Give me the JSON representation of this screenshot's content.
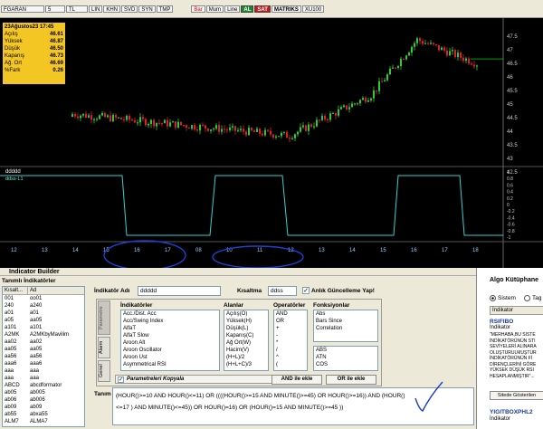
{
  "toolbar": {
    "symbol": "FGARAN",
    "period": "5",
    "currency": "TL",
    "buttons_left": [
      "L",
      "S",
      "LIN",
      "KHN",
      "SVD",
      "SYN",
      "TMP"
    ],
    "buttons_mid": [
      "Trend",
      "Yatay",
      "Prf",
      "Sil",
      "Prf",
      "Sil",
      "Fib",
      "Y",
      "Fibt",
      "Düş",
      "Paran"
    ],
    "buttons_right": [
      "Bar",
      "Mum",
      "Line",
      "Bar",
      "X"
    ],
    "al": "AL",
    "sat": "SAT",
    "matriks": "MATRIKS",
    "zoom": "XU100"
  },
  "info_box": {
    "date": "23Ağustos23 17:45",
    "rows": [
      {
        "label": "Açılış",
        "value": "46.61"
      },
      {
        "label": "Yüksek",
        "value": "46.87"
      },
      {
        "label": "Düşük",
        "value": "46.50"
      },
      {
        "label": "Kapanış",
        "value": "46.73"
      },
      {
        "label": "Ağ. Ort",
        "value": "46.69"
      },
      {
        "label": "%Fark",
        "value": "0.26"
      }
    ]
  },
  "price_axis": [
    "47.5",
    "47",
    "46.5",
    "46",
    "45.5",
    "45",
    "44.5",
    "44",
    "43.5",
    "43",
    "42.5"
  ],
  "indicator_panel": {
    "title": "ddddd",
    "subtitle": "ddss-L1",
    "axis": [
      "1",
      "0.8",
      "0.6",
      "0.4",
      "0.2",
      "0",
      "-0.2",
      "-0.4",
      "-0.6",
      "-0.8",
      "-1"
    ]
  },
  "time_axis": [
    "12",
    "13",
    "14",
    "15",
    "16",
    "17",
    "08",
    "10",
    "11",
    "12",
    "13",
    "14",
    "15",
    "16",
    "17",
    "18"
  ],
  "builder": {
    "window_title": "Indicator Builder",
    "defined_title": "Tanımlı İndikatörler",
    "col_short": "Kısalt...",
    "col_name": "Ad",
    "list": [
      [
        "001",
        "oo01"
      ],
      [
        "240",
        "a240"
      ],
      [
        "a01",
        "a01"
      ],
      [
        "a05",
        "aa05"
      ],
      [
        "a101",
        "a101"
      ],
      [
        "A2MK",
        "A2MKbyMavilim"
      ],
      [
        "aa02",
        "aa02"
      ],
      [
        "aa05",
        "aa05"
      ],
      [
        "aa56",
        "aa56"
      ],
      [
        "aaa6",
        "aaa6"
      ],
      [
        "aaa",
        "aaa"
      ],
      [
        "aaa",
        "aaa"
      ],
      [
        "ABCD",
        "abcdformator"
      ],
      [
        "ab05",
        "ab005"
      ],
      [
        "ab06",
        "ab006"
      ],
      [
        "ab09",
        "ab09"
      ],
      [
        "ab55",
        "abxa55"
      ],
      [
        "ALM7",
        "ALMA7"
      ]
    ],
    "name_label": "İndikatör Adı",
    "name_value": "ddddd",
    "short_label": "Kısaltma",
    "short_value": "ddss",
    "live_label": "Anlık Güncelleme Yap!",
    "side_tabs": [
      "Parametre",
      "Alarm",
      "Genel"
    ],
    "indicators_title": "İndikatörler",
    "indicators": [
      "Acc./Dist. Acc",
      "Acc/Swing Index",
      "AlfaT",
      "AlfaT Slow",
      "Aroon Alt",
      "Aroon Oscillator",
      "Aroon Üst",
      "Asymmetrical RSI"
    ],
    "fields_title": "Alanlar",
    "fields": [
      "Açılış(O)",
      "Yüksek(H)",
      "Düşük(L)",
      "Kapanış(C)",
      "Ağ Ort(W)",
      "Hacim(V)",
      "(H+L)/2",
      "(H+L+C)/3"
    ],
    "operators_title": "Operatörler",
    "operators": [
      "AND",
      "OR",
      "+",
      "-",
      "*",
      "/",
      "^",
      "("
    ],
    "functions_title": "Fonksiyonlar",
    "functions_top": [
      "Abs",
      "Bars Since",
      "Correlation"
    ],
    "functions_bottom": [
      "ABS",
      "ATN",
      "COS"
    ],
    "param_copy": "Parametreleri Kopyala",
    "and_btn": "AND ile ekle",
    "or_btn": "OR ile ekle",
    "def_label": "Tanım",
    "def_line1": "(HOUR()>=10 AND HOUR()<=11) OR ((((HOUR()>=15  AND MINUTE()>=45) OR HOUR()>=16)) AND (HOUR()",
    "def_line2": "<=17 ) AND MINUTE()<=45)) OR HOUR()=16) OR (HOUR()=15  AND MINUTE()>=45 ))"
  },
  "right_panel": {
    "title": "Algo Kütüphane",
    "radio1": "Sistem",
    "radio2": "Tag",
    "tab": "İndikator",
    "item1_title": "RSIFIBO",
    "item1_sub": "İndikator",
    "item1_text": "\"MERHABA,BU SİSTE İNDİKATÖRÜNÜN STI SEVİYELERİ ALINARA OLUŞTURULMUŞTUR İNDİKATÖRÜNÜN Fİ DİRENÇLERİNİ GÖRE YÜKSEK DÜŞÜK RSI HESAPLANMIŞTIR\"...",
    "item1_btn": "Sitede Gösterilen",
    "item2_title": "YIGITBOXPHL2",
    "item2_sub": "İndikator"
  }
}
